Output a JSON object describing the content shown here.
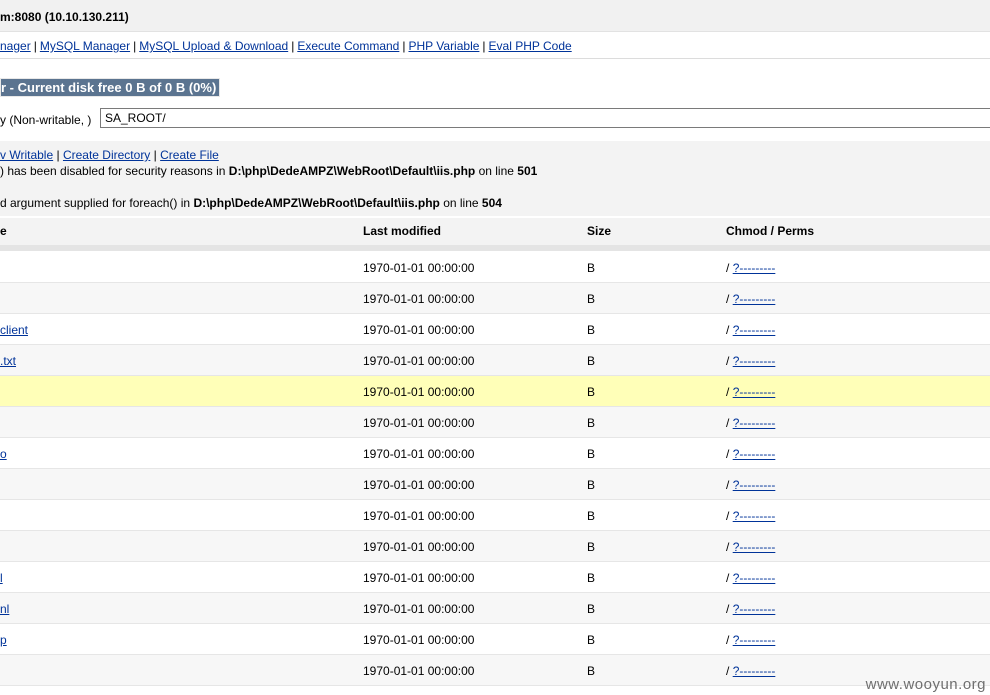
{
  "header": {
    "title": "m:8080 (10.10.130.211)"
  },
  "menu": {
    "items": [
      "nager",
      "MySQL Manager",
      "MySQL Upload & Download",
      "Execute Command",
      "PHP Variable",
      "Eval PHP Code"
    ],
    "separator": "|"
  },
  "section_title": "r - Current disk free 0 B of 0 B (0%)",
  "directory": {
    "label": "y (Non-writable, )",
    "value": "SA_ROOT/"
  },
  "actions": {
    "links": [
      "v Writable",
      "Create Directory",
      "Create File"
    ],
    "separator": "|"
  },
  "warnings": {
    "w1": {
      "text": ") has been disabled for security reasons in ",
      "path": "D:\\php\\DedeAMPZ\\WebRoot\\Default\\iis.php",
      "on_line": " on line ",
      "line": "501"
    },
    "w2": {
      "text": "d argument supplied for foreach() in ",
      "path": "D:\\php\\DedeAMPZ\\WebRoot\\Default\\iis.php",
      "on_line": " on line ",
      "line": "504"
    }
  },
  "table": {
    "headers": {
      "name": "e",
      "modified": "Last modified",
      "size": "Size",
      "perms": "Chmod / Perms"
    },
    "rows": [
      {
        "name": "",
        "modified": "1970-01-01 00:00:00",
        "size": "B",
        "perm_prefix": "/",
        "perm": "?---------"
      },
      {
        "name": "",
        "modified": "1970-01-01 00:00:00",
        "size": "B",
        "perm_prefix": "/",
        "perm": "?---------"
      },
      {
        "name": "client",
        "modified": "1970-01-01 00:00:00",
        "size": "B",
        "perm_prefix": "/",
        "perm": "?---------"
      },
      {
        "name": ".txt",
        "modified": "1970-01-01 00:00:00",
        "size": "B",
        "perm_prefix": "/",
        "perm": "?---------"
      },
      {
        "name": "",
        "modified": "1970-01-01 00:00:00",
        "size": "B",
        "perm_prefix": "/",
        "perm": "?---------"
      },
      {
        "name": "",
        "modified": "1970-01-01 00:00:00",
        "size": "B",
        "perm_prefix": "/",
        "perm": "?---------"
      },
      {
        "name": "o",
        "modified": "1970-01-01 00:00:00",
        "size": "B",
        "perm_prefix": "/",
        "perm": "?---------"
      },
      {
        "name": "",
        "modified": "1970-01-01 00:00:00",
        "size": "B",
        "perm_prefix": "/",
        "perm": "?---------"
      },
      {
        "name": "",
        "modified": "1970-01-01 00:00:00",
        "size": "B",
        "perm_prefix": "/",
        "perm": "?---------"
      },
      {
        "name": "",
        "modified": "1970-01-01 00:00:00",
        "size": "B",
        "perm_prefix": "/",
        "perm": "?---------"
      },
      {
        "name": "l",
        "modified": "1970-01-01 00:00:00",
        "size": "B",
        "perm_prefix": "/",
        "perm": "?---------"
      },
      {
        "name": "nl",
        "modified": "1970-01-01 00:00:00",
        "size": "B",
        "perm_prefix": "/",
        "perm": "?---------"
      },
      {
        "name": "p",
        "modified": "1970-01-01 00:00:00",
        "size": "B",
        "perm_prefix": "/",
        "perm": "?---------"
      },
      {
        "name": "",
        "modified": "1970-01-01 00:00:00",
        "size": "B",
        "perm_prefix": "/",
        "perm": "?---------"
      }
    ]
  },
  "watermark": "www.wooyun.org"
}
